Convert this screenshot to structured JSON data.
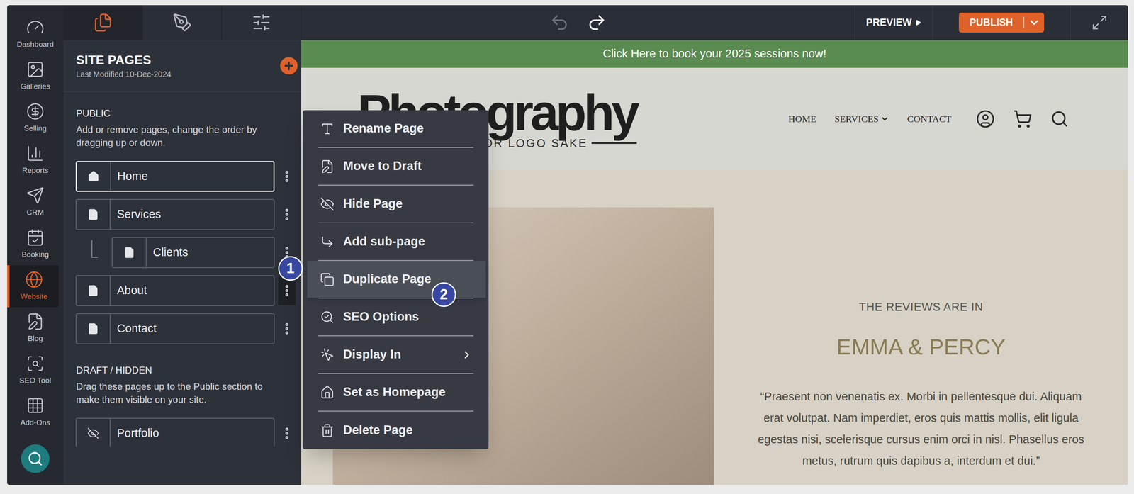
{
  "rail": {
    "items": [
      {
        "label": "Dashboard",
        "selected": false
      },
      {
        "label": "Galleries",
        "selected": false
      },
      {
        "label": "Selling",
        "selected": false
      },
      {
        "label": "Reports",
        "selected": false
      },
      {
        "label": "CRM",
        "selected": false
      },
      {
        "label": "Booking",
        "selected": false
      },
      {
        "label": "Website",
        "selected": true
      },
      {
        "label": "Blog",
        "selected": false
      },
      {
        "label": "SEO Tool",
        "selected": false
      },
      {
        "label": "Add-Ons",
        "selected": false
      }
    ]
  },
  "toolbar": {
    "tool_tabs": [
      {
        "selected": true
      },
      {
        "selected": false
      },
      {
        "selected": false
      }
    ],
    "undo": {
      "disabled": true
    },
    "redo": {
      "disabled": false
    },
    "preview": "PREVIEW",
    "publish": "PUBLISH"
  },
  "panel": {
    "title": "SITE PAGES",
    "modified": "Last Modified 10-Dec-2024",
    "public": {
      "heading": "PUBLIC",
      "description": "Add or remove pages, change the order by dragging up or down."
    },
    "pages": [
      {
        "name": "Home",
        "kind": "home",
        "selected": true,
        "sub": false,
        "menu_open": false
      },
      {
        "name": "Services",
        "kind": "page",
        "selected": false,
        "sub": false,
        "menu_open": false
      },
      {
        "name": "Clients",
        "kind": "page",
        "selected": false,
        "sub": true,
        "menu_open": false
      },
      {
        "name": "About",
        "kind": "page",
        "selected": false,
        "sub": false,
        "menu_open": true
      },
      {
        "name": "Contact",
        "kind": "page",
        "selected": false,
        "sub": false,
        "menu_open": false
      }
    ],
    "draft": {
      "heading": "DRAFT / HIDDEN",
      "description": "Drag these pages up to the Public section to make them visible on your site."
    },
    "draft_pages": [
      {
        "name": "Portfolio",
        "kind": "hidden",
        "selected": false,
        "sub": false,
        "menu_open": false
      }
    ]
  },
  "menu": {
    "items": [
      {
        "label": "Rename Page",
        "selected": false,
        "submenu": false
      },
      {
        "label": "Move to Draft",
        "selected": false,
        "submenu": false
      },
      {
        "label": "Hide Page",
        "selected": false,
        "submenu": false
      },
      {
        "label": "Add sub-page",
        "selected": false,
        "submenu": false
      },
      {
        "label": "Duplicate Page",
        "selected": true,
        "submenu": false
      },
      {
        "label": "SEO Options",
        "selected": false,
        "submenu": false
      },
      {
        "label": "Display In",
        "selected": false,
        "submenu": true
      },
      {
        "label": "Set as Homepage",
        "selected": false,
        "submenu": false
      },
      {
        "label": "Delete Page",
        "selected": false,
        "submenu": false
      }
    ]
  },
  "callouts": [
    {
      "label": "1"
    },
    {
      "label": "2"
    }
  ],
  "site": {
    "banner": "Click Here to book your 2025 sessions now!",
    "logo": "Photography",
    "tagline": "A LOGO FOR LOGO SAKE",
    "nav": [
      {
        "label": "HOME",
        "dropdown": false
      },
      {
        "label": "SERVICES",
        "dropdown": true
      },
      {
        "label": "CONTACT",
        "dropdown": false
      }
    ],
    "review": {
      "eyebrow": "THE REVIEWS ARE IN",
      "names": "EMMA & PERCY",
      "quote": "“Praesent non venenatis ex. Morbi in pellentesque dui. Aliquam erat volutpat. Nam imperdiet, eros quis mattis mollis, elit ligula egestas nisi, scelerisque cursus enim orci in nisl. Phasellus eros metus, rutrum quis dapibus a, interdum et dui.”"
    }
  }
}
